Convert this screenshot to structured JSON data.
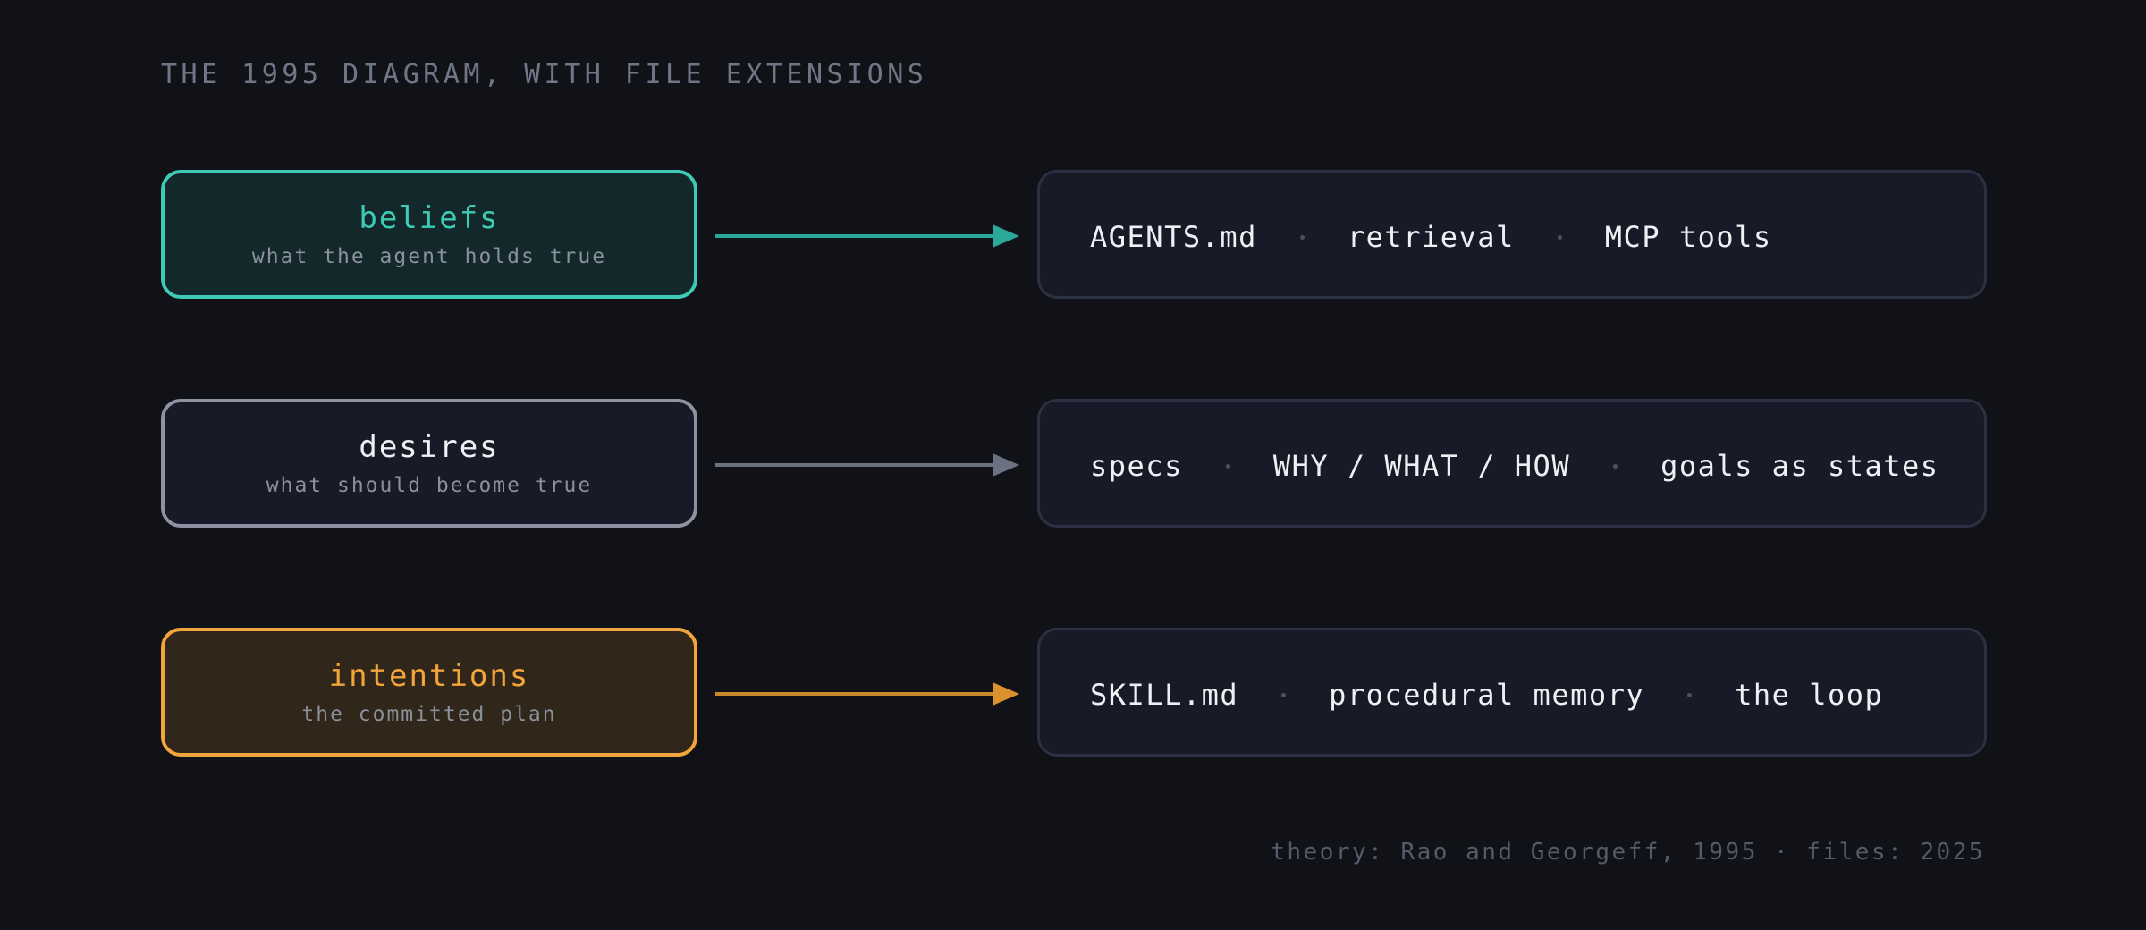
{
  "title": "THE 1995 DIAGRAM, WITH FILE EXTENSIONS",
  "rows": [
    {
      "name": "beliefs",
      "description": "what the agent holds true",
      "color": "#3ecbb6",
      "items": [
        "AGENTS.md",
        "retrieval",
        "MCP tools"
      ]
    },
    {
      "name": "desires",
      "description": "what should become true",
      "color": "#8e93a2",
      "items": [
        "specs",
        "WHY / WHAT / HOW",
        "goals as states"
      ]
    },
    {
      "name": "intentions",
      "description": "the committed plan",
      "color": "#f2a53a",
      "items": [
        "SKILL.md",
        "procedural memory",
        "the loop"
      ]
    }
  ],
  "footnote": "theory: Rao and Georgeff, 1995 · files: 2025"
}
